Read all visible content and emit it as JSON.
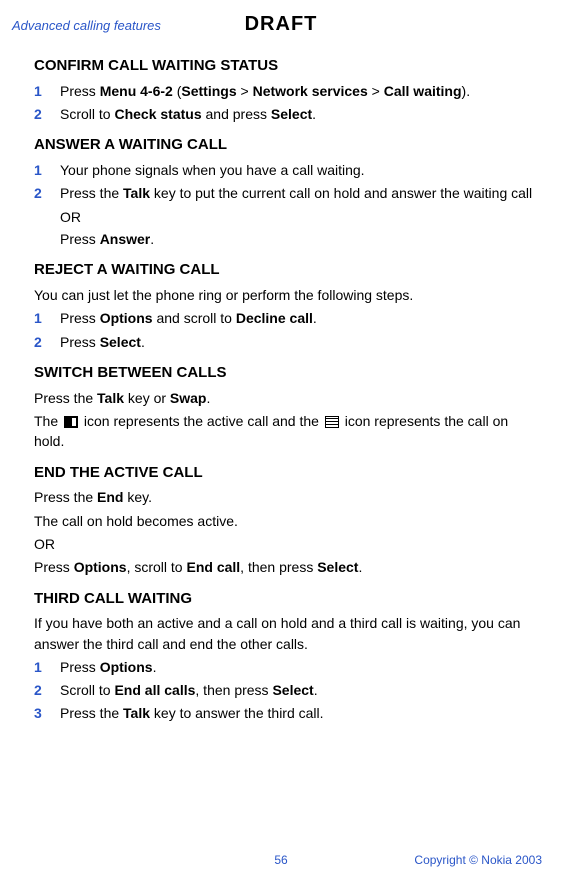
{
  "header": {
    "section": "Advanced calling features",
    "draft": "DRAFT"
  },
  "confirm": {
    "title": "CONFIRM CALL WAITING STATUS",
    "step1_a": "Press ",
    "step1_b": "Menu 4-6-2",
    "step1_c": " (",
    "step1_d": "Settings",
    "step1_e": " > ",
    "step1_f": "Network services",
    "step1_g": " > ",
    "step1_h": "Call waiting",
    "step1_i": ").",
    "step2_a": "Scroll to ",
    "step2_b": "Check status",
    "step2_c": " and press ",
    "step2_d": "Select",
    "step2_e": "."
  },
  "answer": {
    "title": "ANSWER A WAITING CALL",
    "step1": "Your phone signals when you have a call waiting.",
    "step2_a": "Press the ",
    "step2_b": "Talk",
    "step2_c": " key to put the current call on hold and answer the waiting call",
    "or": "OR",
    "step2_d": "Press ",
    "step2_e": "Answer",
    "step2_f": "."
  },
  "reject": {
    "title": "REJECT A WAITING CALL",
    "intro": "You can just let the phone ring or perform the following steps.",
    "step1_a": "Press ",
    "step1_b": "Options",
    "step1_c": " and scroll to ",
    "step1_d": "Decline call",
    "step1_e": ".",
    "step2_a": "Press ",
    "step2_b": "Select",
    "step2_c": "."
  },
  "switch": {
    "title": "SWITCH BETWEEN CALLS",
    "p1_a": "Press the ",
    "p1_b": "Talk",
    "p1_c": " key or ",
    "p1_d": "Swap",
    "p1_e": ".",
    "p2_a": "The ",
    "p2_b": " icon represents the active call and the ",
    "p2_c": " icon represents the call on hold."
  },
  "end": {
    "title": "END THE ACTIVE CALL",
    "p1_a": "Press the ",
    "p1_b": "End",
    "p1_c": " key.",
    "p2": "The call on hold becomes active.",
    "or": "OR",
    "p3_a": "Press ",
    "p3_b": "Options",
    "p3_c": ", scroll to ",
    "p3_d": "End call",
    "p3_e": ", then press ",
    "p3_f": "Select",
    "p3_g": "."
  },
  "third": {
    "title": "THIRD CALL WAITING",
    "intro": "If you have both an active and a call on hold and a third call is waiting, you can answer the third call and end the other calls.",
    "step1_a": "Press ",
    "step1_b": "Options",
    "step1_c": ".",
    "step2_a": "Scroll to ",
    "step2_b": "End all calls",
    "step2_c": ", then press ",
    "step2_d": "Select",
    "step2_e": ".",
    "step3_a": "Press the ",
    "step3_b": "Talk",
    "step3_c": " key to answer the third call."
  },
  "footer": {
    "page": "56",
    "copyright": "Copyright © Nokia 2003"
  },
  "nums": {
    "n1": "1",
    "n2": "2",
    "n3": "3"
  }
}
